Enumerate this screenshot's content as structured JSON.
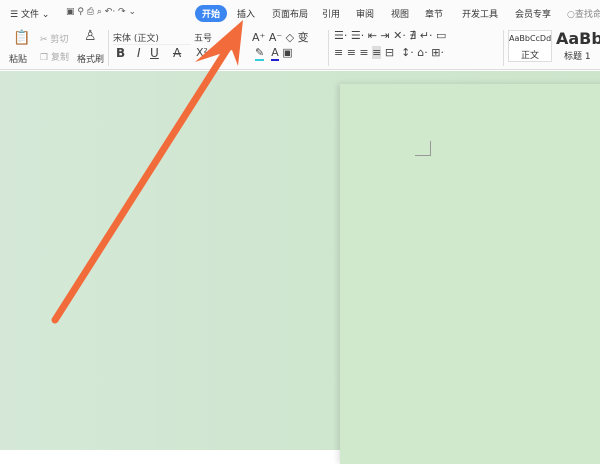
{
  "menu": {
    "file": "文件",
    "tabs": [
      "开始",
      "插入",
      "页面布局",
      "引用",
      "审阅",
      "视图",
      "章节",
      "开发工具",
      "会员专享"
    ],
    "search": "查找命"
  },
  "ribbon": {
    "paste": "粘贴",
    "cut": "剪切",
    "copy": "复制",
    "format_painter": "格式刷",
    "font": "宋体 (正文)",
    "size": "五号",
    "bold": "B",
    "italic": "I",
    "underline": "U",
    "strike": "A",
    "superscript": "X²"
  },
  "styles": {
    "normal_preview": "AaBbCcDd",
    "normal": "正文",
    "h1_preview": "AaBb",
    "h1": "标题 1"
  },
  "colors": {
    "accent": "#3b86f0",
    "arrow": "#f26b3a"
  }
}
